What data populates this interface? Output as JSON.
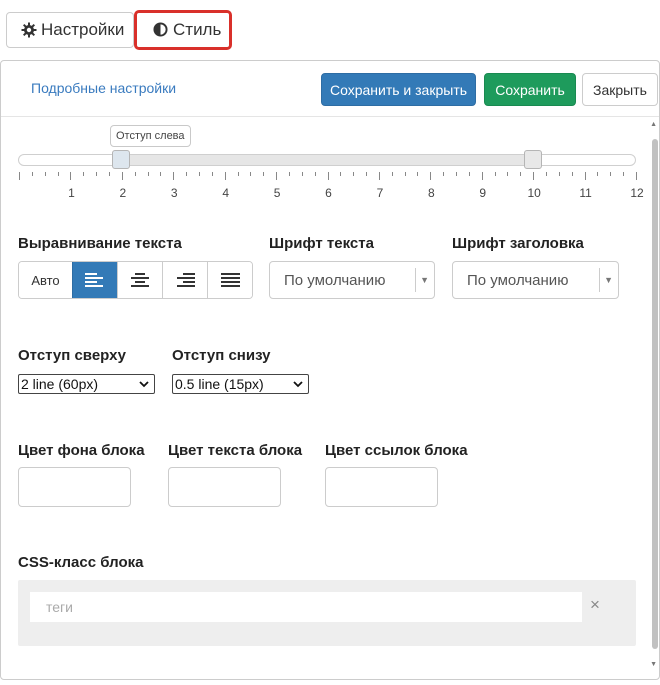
{
  "tabs": {
    "settings_label": "Настройки",
    "style_label": "Стиль"
  },
  "header": {
    "detail_link": "Подробные настройки",
    "save_close_label": "Сохранить и закрыть",
    "save_label": "Сохранить",
    "close_label": "Закрыть"
  },
  "slider": {
    "tooltip": "Отступ слева",
    "min": 0,
    "max": 12,
    "low": 2,
    "high": 10,
    "tick_labels": [
      "1",
      "2",
      "3",
      "4",
      "5",
      "6",
      "7",
      "8",
      "9",
      "10",
      "11",
      "12"
    ]
  },
  "align": {
    "label": "Выравнивание текста",
    "auto_label": "Авто",
    "selected": "left"
  },
  "font_text": {
    "label": "Шрифт текста",
    "value": "По умолчанию"
  },
  "font_heading": {
    "label": "Шрифт заголовка",
    "value": "По умолчанию"
  },
  "padding_top": {
    "label": "Отступ сверху",
    "value": "2 line (60px)"
  },
  "padding_bottom": {
    "label": "Отступ снизу",
    "value": "0.5 line (15px)"
  },
  "colors": {
    "bg_label": "Цвет фона блока",
    "text_label": "Цвет текста блока",
    "link_label": "Цвет ссылок блока"
  },
  "css_class": {
    "label": "CSS-класс блока",
    "placeholder": "теги",
    "clear_symbol": "×"
  },
  "style_colors": {
    "primary": "#337ab7",
    "success": "#1e9b5c",
    "highlight": "#d9302a"
  }
}
